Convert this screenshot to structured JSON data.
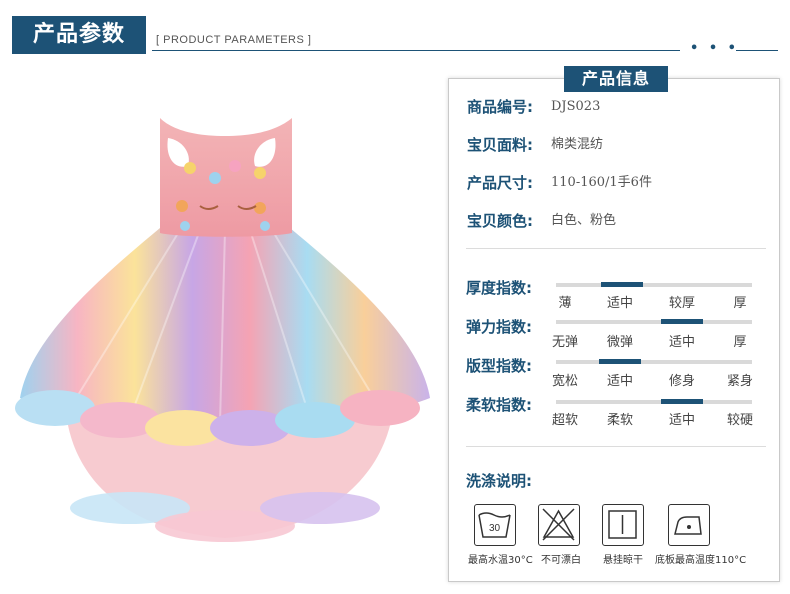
{
  "header": {
    "title": "产品参数",
    "subtitle": "[ PRODUCT PARAMETERS ]",
    "dots": "• • •"
  },
  "panel": {
    "tab_title": "产品信息",
    "info": [
      {
        "label": "商品编号:",
        "value": "DJS023"
      },
      {
        "label": "宝贝面料:",
        "value": "棉类混纺"
      },
      {
        "label": "产品尺寸:",
        "value": "110-160/1手6件"
      },
      {
        "label": "宝贝颜色:",
        "value": "白色、粉色"
      }
    ],
    "indices": [
      {
        "label": "厚度指数:",
        "options": [
          "薄",
          "适中",
          "较厚",
          "厚"
        ],
        "selected": 1
      },
      {
        "label": "弹力指数:",
        "options": [
          "无弹",
          "微弹",
          "适中",
          "厚"
        ],
        "selected": 2
      },
      {
        "label": "版型指数:",
        "options": [
          "宽松",
          "适中",
          "修身",
          "紧身"
        ],
        "selected": 1
      },
      {
        "label": "柔软指数:",
        "options": [
          "超软",
          "柔软",
          "适中",
          "较硬"
        ],
        "selected": 2
      }
    ],
    "wash": {
      "label": "洗涤说明:",
      "items": [
        {
          "icon": "wash-30-icon",
          "glyph": "30",
          "caption": "最高水温30°C"
        },
        {
          "icon": "no-bleach-icon",
          "caption": "不可漂白"
        },
        {
          "icon": "hang-dry-icon",
          "caption": "悬挂晾干"
        },
        {
          "icon": "iron-icon",
          "caption": "底板最高温度110°C"
        }
      ]
    }
  },
  "colors": {
    "accent": "#1d5276",
    "dress_pink": "#f0a3ab"
  }
}
